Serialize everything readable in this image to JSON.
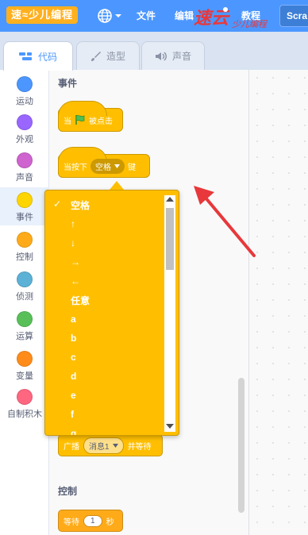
{
  "menubar": {
    "logo_text": "速≈少儿编程",
    "file_label": "文件",
    "edit_label": "编辑",
    "tutorial_label": "教程",
    "scratch_label": "Scra",
    "watermark_text": "速云少儿编程"
  },
  "tabs": [
    {
      "label": "代码",
      "icon": "code-icon",
      "active": true
    },
    {
      "label": "造型",
      "icon": "brush-icon",
      "active": false
    },
    {
      "label": "声音",
      "icon": "speaker-icon",
      "active": false
    }
  ],
  "categories": [
    {
      "label": "运动",
      "color": "#4c97ff"
    },
    {
      "label": "外观",
      "color": "#9966ff"
    },
    {
      "label": "声音",
      "color": "#cf63cf"
    },
    {
      "label": "事件",
      "color": "#ffd500"
    },
    {
      "label": "控制",
      "color": "#ffab19"
    },
    {
      "label": "侦测",
      "color": "#5cb1d6"
    },
    {
      "label": "运算",
      "color": "#59c059"
    },
    {
      "label": "变量",
      "color": "#ff8c1a"
    },
    {
      "label": "自制积木",
      "color": "#ff6680"
    }
  ],
  "palette": {
    "events_title": "事件",
    "when_flag": {
      "prefix": "当",
      "suffix": "被点击"
    },
    "when_key": {
      "prefix": "当按下",
      "key": "空格",
      "suffix": "键"
    },
    "broadcast_wait": {
      "prefix": "广播",
      "message": "消息1",
      "suffix": "并等待"
    },
    "control_title": "控制",
    "wait_block": {
      "prefix": "等待",
      "value": "1",
      "suffix": "秒"
    }
  },
  "dropdown": {
    "selected": "空格",
    "options": [
      "空格",
      "↑",
      "↓",
      "→",
      "←",
      "任意",
      "a",
      "b",
      "c",
      "d",
      "e",
      "f",
      "g"
    ]
  },
  "colors": {
    "menubar": "#4c97ff",
    "events": "#ffbf00",
    "control": "#ffab19",
    "arrow": "#e8383b"
  }
}
